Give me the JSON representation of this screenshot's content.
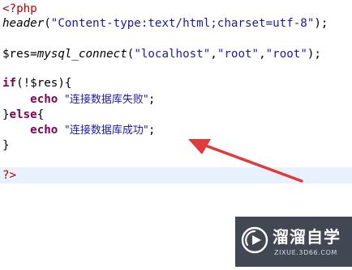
{
  "code": {
    "php_open": "<?php",
    "header_fn": "header",
    "header_open": "(",
    "header_arg": "\"Content-type:text/html;charset=utf-8\"",
    "header_close": ");",
    "res_assign": "$res=",
    "connect_fn": "mysql_connect",
    "connect_open": "(",
    "host": "\"localhost\"",
    "comma1": ",",
    "user": "\"root\"",
    "comma2": ",",
    "pass": "\"root\"",
    "connect_close": ");",
    "if_kw": "if",
    "if_cond": "(!$res){",
    "echo1_kw": "echo",
    "echo1_str": "\"连接数据库失败\"",
    "echo1_end": ";",
    "else_open": "}",
    "else_kw": "else",
    "else_brace": "{",
    "echo2_kw": "echo",
    "echo2_str": "\"连接数据库成功\"",
    "echo2_end": ";",
    "close_brace": "}",
    "php_close": "?>"
  },
  "annotation": {
    "arrow_color": "#e03a3a"
  },
  "watermark": {
    "title": "溜溜自学",
    "subtitle": "ZIXUE.3D66.COM"
  },
  "colors": {
    "php_tag": "#b40000",
    "string": "#1a1aa6",
    "keyword": "#7f0055",
    "highlight_line": "#e8f2fe"
  }
}
